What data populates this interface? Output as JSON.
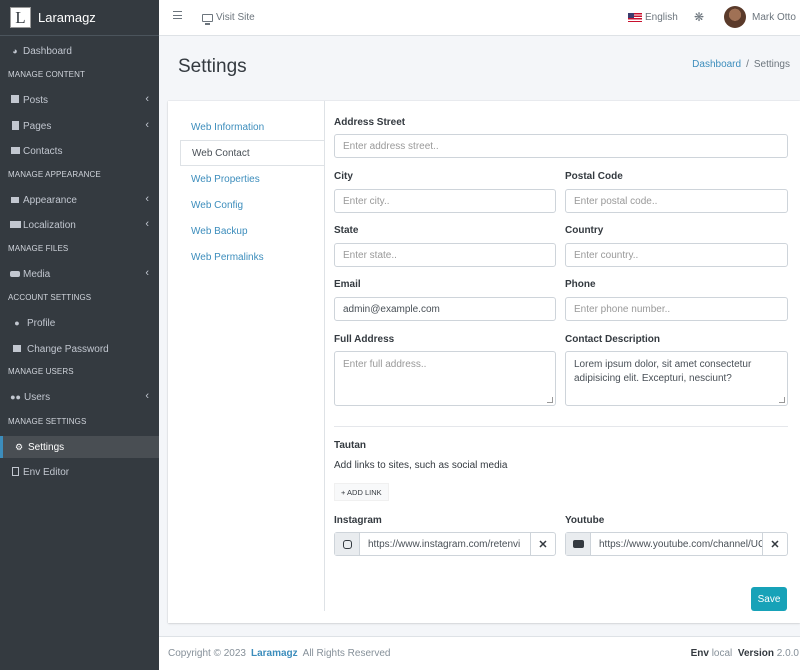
{
  "brand": {
    "logo_letter": "L",
    "name": "Laramagz"
  },
  "sidebar": {
    "dashboard": "Dashboard",
    "h_content": "MANAGE CONTENT",
    "posts": "Posts",
    "pages": "Pages",
    "contacts": "Contacts",
    "h_appearance": "MANAGE APPEARANCE",
    "appearance": "Appearance",
    "localization": "Localization",
    "h_files": "MANAGE FILES",
    "media": "Media",
    "h_account": "ACCOUNT SETTINGS",
    "profile": "Profile",
    "change_password": "Change Password",
    "h_users": "MANAGE USERS",
    "users": "Users",
    "h_settings": "MANAGE SETTINGS",
    "settings": "Settings",
    "env_editor": "Env Editor",
    "chevron": "‹"
  },
  "topbar": {
    "visit_site": "Visit Site",
    "language": "English",
    "user_name": "Mark Otto"
  },
  "page": {
    "title": "Settings",
    "breadcrumb_home": "Dashboard",
    "breadcrumb_sep": "/",
    "breadcrumb_current": "Settings"
  },
  "tabs": [
    "Web Information",
    "Web Contact",
    "Web Properties",
    "Web Config",
    "Web Backup",
    "Web Permalinks"
  ],
  "form": {
    "address_street": {
      "label": "Address Street",
      "placeholder": "Enter address street.."
    },
    "city": {
      "label": "City",
      "placeholder": "Enter city.."
    },
    "postal_code": {
      "label": "Postal Code",
      "placeholder": "Enter postal code.."
    },
    "state": {
      "label": "State",
      "placeholder": "Enter state.."
    },
    "country": {
      "label": "Country",
      "placeholder": "Enter country.."
    },
    "email": {
      "label": "Email",
      "value": "admin@example.com"
    },
    "phone": {
      "label": "Phone",
      "placeholder": "Enter phone number.."
    },
    "full_address": {
      "label": "Full Address",
      "placeholder": "Enter full address.."
    },
    "contact_description": {
      "label": "Contact Description",
      "value": "Lorem ipsum dolor, sit amet consectetur adipisicing elit. Excepturi, nesciunt?"
    }
  },
  "tautan": {
    "title": "Tautan",
    "help": "Add links to sites, such as social media",
    "add_link": "+ ADD LINK",
    "instagram": {
      "label": "Instagram",
      "value": "https://www.instagram.com/retenvi"
    },
    "youtube": {
      "label": "Youtube",
      "value": "https://www.youtube.com/channel/UC"
    },
    "remove": "✕"
  },
  "save_label": "Save",
  "footer": {
    "copyright": "Copyright © 2023",
    "brand": "Laramagz",
    "rights": "All Rights Reserved",
    "env_label": "Env",
    "env_value": "local",
    "version_label": "Version",
    "version_value": "2.0.0"
  },
  "colors": {
    "sidebar_bg": "#343a40",
    "link": "#3c8dbc",
    "save_button": "#17a2b8"
  }
}
